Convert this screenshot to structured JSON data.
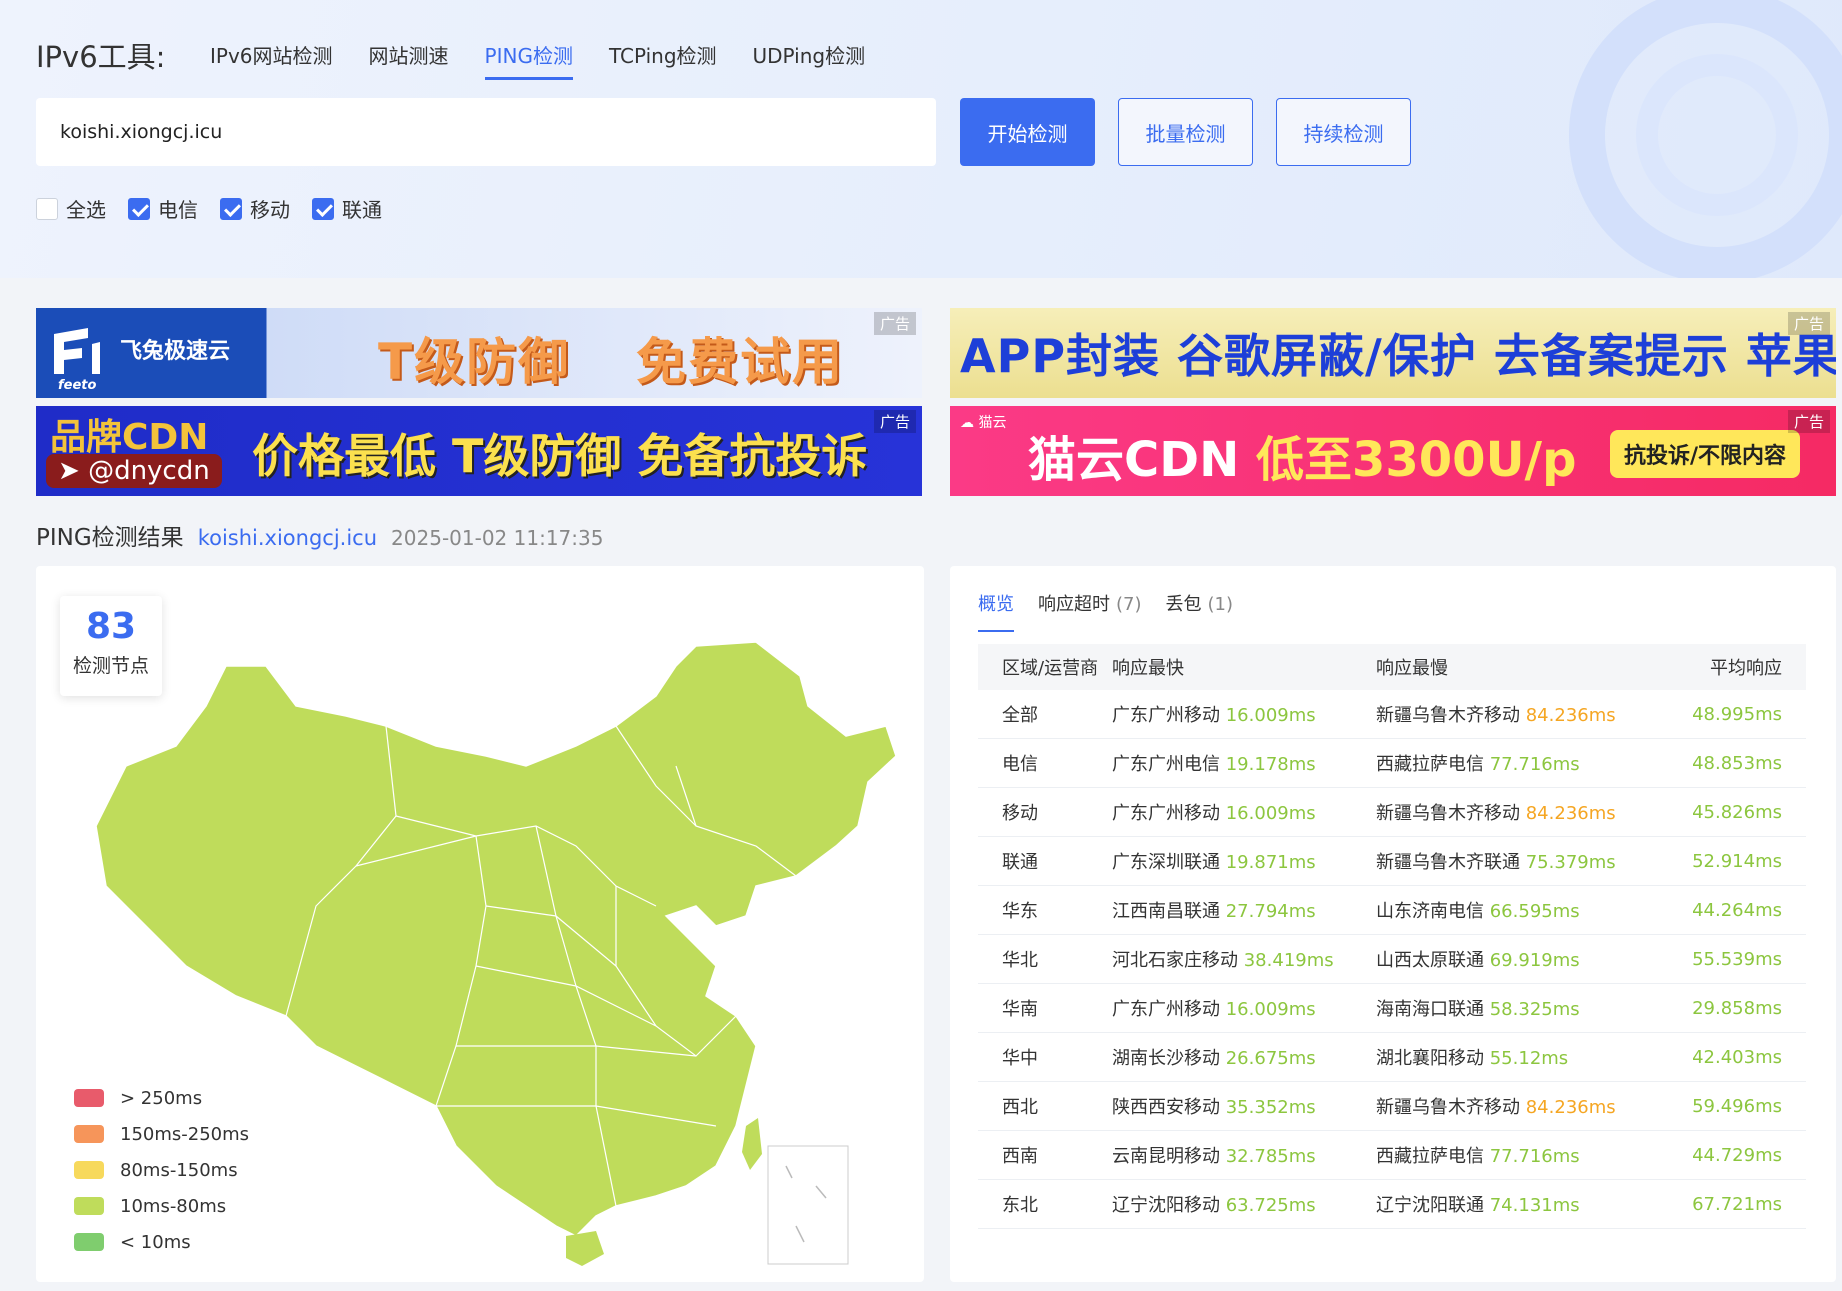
{
  "header": {
    "tool_title": "IPv6工具:",
    "nav": [
      "IPv6网站检测",
      "网站测速",
      "PING检测",
      "TCPing检测",
      "UDPing检测"
    ],
    "active_nav": "PING检测",
    "search": {
      "value": "koishi.xiongcj.icu",
      "placeholder": ""
    },
    "buttons": {
      "start": "开始检测",
      "batch": "批量检测",
      "continuous": "持续检测"
    },
    "checkboxes": [
      {
        "label": "全选",
        "checked": false
      },
      {
        "label": "电信",
        "checked": true
      },
      {
        "label": "移动",
        "checked": true
      },
      {
        "label": "联通",
        "checked": true
      }
    ]
  },
  "ads": {
    "tag": "广告",
    "ad1": {
      "brand": "飞兔极速云",
      "sub": "feeto",
      "text1": "T级防御",
      "text2": "免费试用"
    },
    "ad2": {
      "text": "APP封装 谷歌屏蔽/保护 去备案提示 苹果签名"
    },
    "ad3": {
      "brand": "品牌CDN",
      "handle": "@dnycdn",
      "text": "价格最低 T级防御 免备抗投诉"
    },
    "ad4": {
      "small": "猫云",
      "text_a": "猫云CDN ",
      "text_b": "低至3300U/p",
      "pill": "抗投诉/不限内容"
    }
  },
  "result": {
    "title": "PING检测结果",
    "domain": "koishi.xiongcj.icu",
    "time": "2025-01-02 11:17:35"
  },
  "map": {
    "count": "83",
    "count_label": "检测节点",
    "legend": [
      {
        "label": "> 250ms",
        "color": "#e85b6b"
      },
      {
        "label": "150ms-250ms",
        "color": "#f6955a"
      },
      {
        "label": "80ms-150ms",
        "color": "#f7d95c"
      },
      {
        "label": "10ms-80ms",
        "color": "#bfdc5b"
      },
      {
        "label": "< 10ms",
        "color": "#7fcd6e"
      }
    ],
    "fill_color": "#bfdc5b"
  },
  "tabs": [
    {
      "label": "概览",
      "count": ""
    },
    {
      "label": "响应超时",
      "count": "(7)"
    },
    {
      "label": "丢包",
      "count": "(1)"
    }
  ],
  "table": {
    "headers": [
      "区域/运营商",
      "响应最快",
      "响应最慢",
      "平均响应"
    ],
    "rows": [
      {
        "region": "全部",
        "fast_loc": "广东广州移动",
        "fast_ms": "16.009ms",
        "slow_loc": "新疆乌鲁木齐移动",
        "slow_ms": "84.236ms",
        "slow_orange": true,
        "avg": "48.995ms"
      },
      {
        "region": "电信",
        "fast_loc": "广东广州电信",
        "fast_ms": "19.178ms",
        "slow_loc": "西藏拉萨电信",
        "slow_ms": "77.716ms",
        "slow_orange": false,
        "avg": "48.853ms"
      },
      {
        "region": "移动",
        "fast_loc": "广东广州移动",
        "fast_ms": "16.009ms",
        "slow_loc": "新疆乌鲁木齐移动",
        "slow_ms": "84.236ms",
        "slow_orange": true,
        "avg": "45.826ms"
      },
      {
        "region": "联通",
        "fast_loc": "广东深圳联通",
        "fast_ms": "19.871ms",
        "slow_loc": "新疆乌鲁木齐联通",
        "slow_ms": "75.379ms",
        "slow_orange": false,
        "avg": "52.914ms"
      },
      {
        "region": "华东",
        "fast_loc": "江西南昌联通",
        "fast_ms": "27.794ms",
        "slow_loc": "山东济南电信",
        "slow_ms": "66.595ms",
        "slow_orange": false,
        "avg": "44.264ms"
      },
      {
        "region": "华北",
        "fast_loc": "河北石家庄移动",
        "fast_ms": "38.419ms",
        "slow_loc": "山西太原联通",
        "slow_ms": "69.919ms",
        "slow_orange": false,
        "avg": "55.539ms"
      },
      {
        "region": "华南",
        "fast_loc": "广东广州移动",
        "fast_ms": "16.009ms",
        "slow_loc": "海南海口联通",
        "slow_ms": "58.325ms",
        "slow_orange": false,
        "avg": "29.858ms"
      },
      {
        "region": "华中",
        "fast_loc": "湖南长沙移动",
        "fast_ms": "26.675ms",
        "slow_loc": "湖北襄阳移动",
        "slow_ms": "55.12ms",
        "slow_orange": false,
        "avg": "42.403ms"
      },
      {
        "region": "西北",
        "fast_loc": "陕西西安移动",
        "fast_ms": "35.352ms",
        "slow_loc": "新疆乌鲁木齐移动",
        "slow_ms": "84.236ms",
        "slow_orange": true,
        "avg": "59.496ms"
      },
      {
        "region": "西南",
        "fast_loc": "云南昆明移动",
        "fast_ms": "32.785ms",
        "slow_loc": "西藏拉萨电信",
        "slow_ms": "77.716ms",
        "slow_orange": false,
        "avg": "44.729ms"
      },
      {
        "region": "东北",
        "fast_loc": "辽宁沈阳移动",
        "fast_ms": "63.725ms",
        "slow_loc": "辽宁沈阳联通",
        "slow_ms": "74.131ms",
        "slow_orange": false,
        "avg": "67.721ms"
      }
    ]
  }
}
